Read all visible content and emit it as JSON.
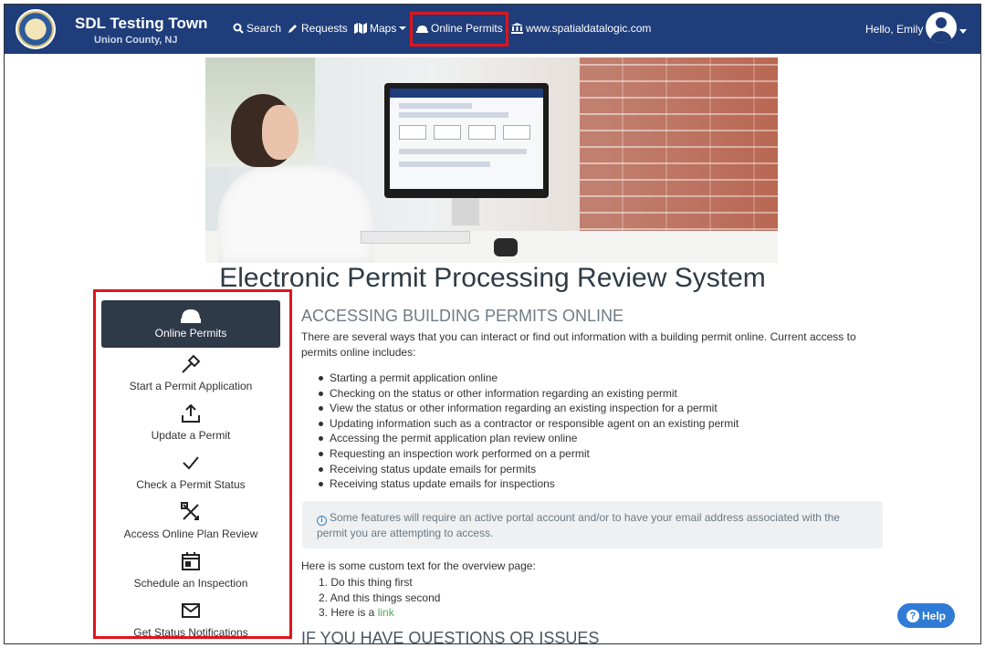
{
  "header": {
    "brand_title": "SDL Testing Town",
    "brand_subtitle": "Union County, NJ",
    "nav": {
      "search": "Search",
      "requests": "Requests",
      "maps": "Maps",
      "online_permits": "Online Permits",
      "website": "www.spatialdatalogic.com"
    },
    "greeting": "Hello, Emily"
  },
  "page_title": "Electronic Permit Processing Review System",
  "side_menu": [
    {
      "label": "Online Permits",
      "icon": "hard-hat-icon",
      "active": true
    },
    {
      "label": "Start a Permit Application",
      "icon": "hammer-icon",
      "active": false
    },
    {
      "label": "Update a Permit",
      "icon": "upload-tray-icon",
      "active": false
    },
    {
      "label": "Check a Permit Status",
      "icon": "checkmark-icon",
      "active": false
    },
    {
      "label": "Access Online Plan Review",
      "icon": "ruler-pencil-icon",
      "active": false
    },
    {
      "label": "Schedule an Inspection",
      "icon": "calendar-icon",
      "active": false
    },
    {
      "label": "Get Status Notifications",
      "icon": "envelope-icon",
      "active": false
    }
  ],
  "content": {
    "heading": "ACCESSING BUILDING PERMITS ONLINE",
    "intro": "There are several ways that you can interact or find out information with a building permit online. Current access to permits online includes:",
    "bullets": [
      "Starting a permit application online",
      "Checking on the status or other information regarding an existing permit",
      "View the status or other information regarding an existing inspection for a permit",
      "Updating information such as a contractor or responsible agent on an existing permit",
      "Accessing the permit application plan review online",
      "Requesting an inspection work performed on a permit",
      "Receiving status update emails for permits",
      "Receiving status update emails for inspections"
    ],
    "alert": "Some features will require an active portal account and/or to have your email address associated with the permit you are attempting to access.",
    "custom_text": "Here is some custom text for the overview page:",
    "steps": {
      "one": "1. Do this thing first",
      "two": "2. And this things second",
      "three_prefix": "3. Here is a ",
      "three_link": "link"
    },
    "heading_2": "IF YOU HAVE QUESTIONS OR ISSUES"
  },
  "help_button": "Help",
  "colors": {
    "navbar": "#1f3d7a",
    "active_menu": "#2f3a49",
    "highlight_border": "#e0141b",
    "help_button": "#2f7bd6",
    "link": "#4caf50"
  }
}
